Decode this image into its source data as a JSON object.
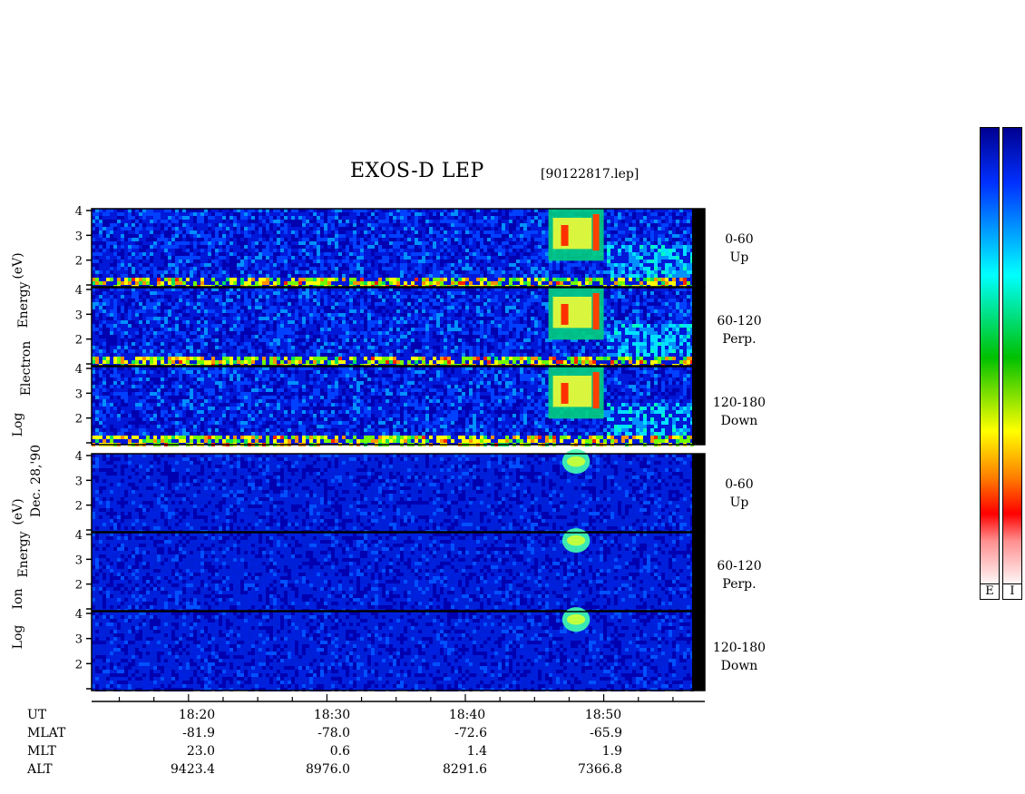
{
  "header": {
    "title": "EXOS-D LEP",
    "file": "[90122817.lep]"
  },
  "date_label": "Dec. 28,'90",
  "electron_axis_label": [
    "Log",
    "Electron",
    "Energy",
    "(eV)"
  ],
  "ion_axis_label": [
    "Log",
    "Ion",
    "Energy",
    "(eV)"
  ],
  "panels": [
    {
      "species": "electron",
      "label1": "0-60",
      "label2": "Up"
    },
    {
      "species": "electron",
      "label1": "60-120",
      "label2": "Perp."
    },
    {
      "species": "electron",
      "label1": "120-180",
      "label2": "Down"
    },
    {
      "species": "ion",
      "label1": "0-60",
      "label2": "Up"
    },
    {
      "species": "ion",
      "label1": "60-120",
      "label2": "Perp."
    },
    {
      "species": "ion",
      "label1": "120-180",
      "label2": "Down"
    }
  ],
  "ephemeris": {
    "rows": [
      {
        "name": "UT",
        "values": [
          "18:20",
          "18:30",
          "18:40",
          "18:50"
        ]
      },
      {
        "name": "MLAT",
        "values": [
          "-81.9",
          "-78.0",
          "-72.6",
          "-65.9"
        ]
      },
      {
        "name": "MLT",
        "values": [
          "23.0",
          "0.6",
          "1.4",
          "1.9"
        ]
      },
      {
        "name": "ALT",
        "values": [
          "9423.4",
          "8976.0",
          "8291.6",
          "7366.8"
        ]
      }
    ]
  },
  "colorbars": [
    {
      "label": "E"
    },
    {
      "label": "I"
    }
  ],
  "chart_data": {
    "type": "heatmap",
    "title": "EXOS-D LEP",
    "xlabel": "UT",
    "x_ticks": [
      "18:20",
      "18:30",
      "18:40",
      "18:50"
    ],
    "x_range_minutes": [
      "18:13",
      "18:57"
    ],
    "ylabel_electron": "Log Electron Energy (eV)",
    "ylabel_ion": "Log Ion Energy (eV)",
    "y_ticks": [
      1,
      2,
      3,
      4
    ],
    "y_range": [
      1,
      4
    ],
    "pitch_angle_bins": [
      "0-60 Up",
      "60-120 Perp.",
      "120-180 Down"
    ],
    "features": [
      {
        "species": "electron",
        "description": "intense precipitation burst",
        "start": "18:46",
        "end": "18:50",
        "energy_range": [
          2.0,
          4.0
        ]
      },
      {
        "species": "ion",
        "description": "ion burst",
        "start": "18:47",
        "end": "18:49",
        "energy_range": [
          3.3,
          4.1
        ]
      }
    ],
    "colormap": [
      "#ffffff",
      "#ff0000",
      "#ff8000",
      "#ffff00",
      "#00c000",
      "#00ffff",
      "#0060ff",
      "#000090"
    ]
  }
}
